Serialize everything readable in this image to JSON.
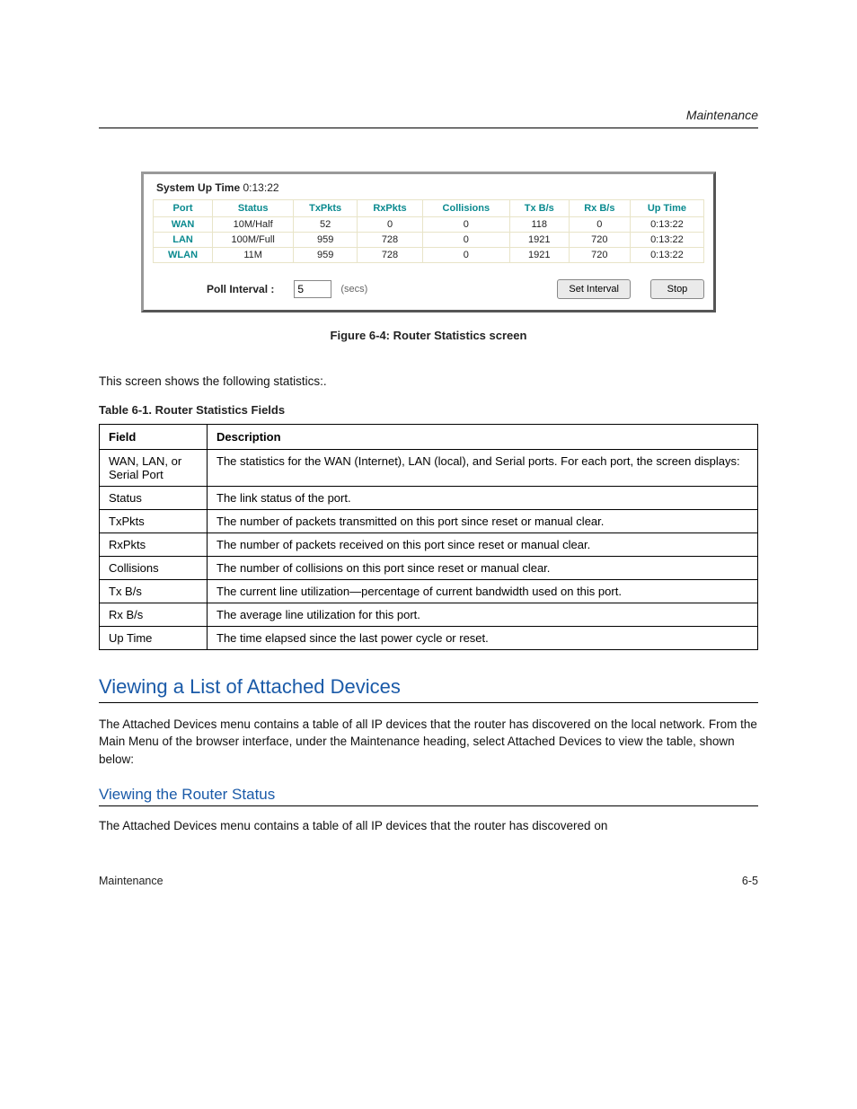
{
  "header": {
    "chapter": "Maintenance"
  },
  "panel": {
    "uptime_label": "System Up Time",
    "uptime_value": "0:13:22",
    "cols": [
      "Port",
      "Status",
      "TxPkts",
      "RxPkts",
      "Collisions",
      "Tx B/s",
      "Rx B/s",
      "Up Time"
    ],
    "rows": [
      {
        "port": "WAN",
        "status": "10M/Half",
        "tx": "52",
        "rx": "0",
        "col": "0",
        "txbs": "118",
        "rxbs": "0",
        "up": "0:13:22"
      },
      {
        "port": "LAN",
        "status": "100M/Full",
        "tx": "959",
        "rx": "728",
        "col": "0",
        "txbs": "1921",
        "rxbs": "720",
        "up": "0:13:22"
      },
      {
        "port": "WLAN",
        "status": "11M",
        "tx": "959",
        "rx": "728",
        "col": "0",
        "txbs": "1921",
        "rxbs": "720",
        "up": "0:13:22"
      }
    ],
    "poll_label": "Poll Interval :",
    "poll_value": "5",
    "poll_units": "(secs)",
    "set_btn": "Set Interval",
    "stop_btn": "Stop"
  },
  "figure_caption": "Figure 6-4:  Router Statistics screen",
  "intro": "This screen shows the following statistics:.",
  "fields_caption": "Table 6-1. Router Statistics Fields",
  "fields": {
    "cols": [
      "Field",
      "Description"
    ],
    "rows": [
      {
        "f": "WAN, LAN, or Serial Port",
        "d": "The statistics for the WAN (Internet), LAN (local), and Serial ports. For each port, the screen displays:"
      },
      {
        "f": "Status",
        "d": "The link status of the port."
      },
      {
        "f": "TxPkts",
        "d": "The number of packets transmitted on this port since reset or manual clear."
      },
      {
        "f": "RxPkts",
        "d": "The number of packets received on this port since reset or manual clear."
      },
      {
        "f": "Collisions",
        "d": "The number of collisions on this port since reset or manual clear."
      },
      {
        "f": "Tx B/s",
        "d": "The current line utilization—percentage of current bandwidth used on this port."
      },
      {
        "f": "Rx B/s",
        "d": "The average line utilization for this port."
      },
      {
        "f": "Up Time",
        "d": "The time elapsed since the last power cycle or reset."
      }
    ]
  },
  "h2": "Viewing a List of Attached Devices",
  "p_h2": "The Attached Devices menu contains a table of all IP devices that the router has discovered on the local network. From the Main Menu of the browser interface, under the Maintenance heading, select Attached Devices to view the table, shown below:",
  "h3": "Viewing the Router Status",
  "p_h3": "The Attached Devices menu contains a table of all IP devices that the router has discovered on",
  "footer": {
    "left": "Maintenance",
    "right": "6-5"
  }
}
